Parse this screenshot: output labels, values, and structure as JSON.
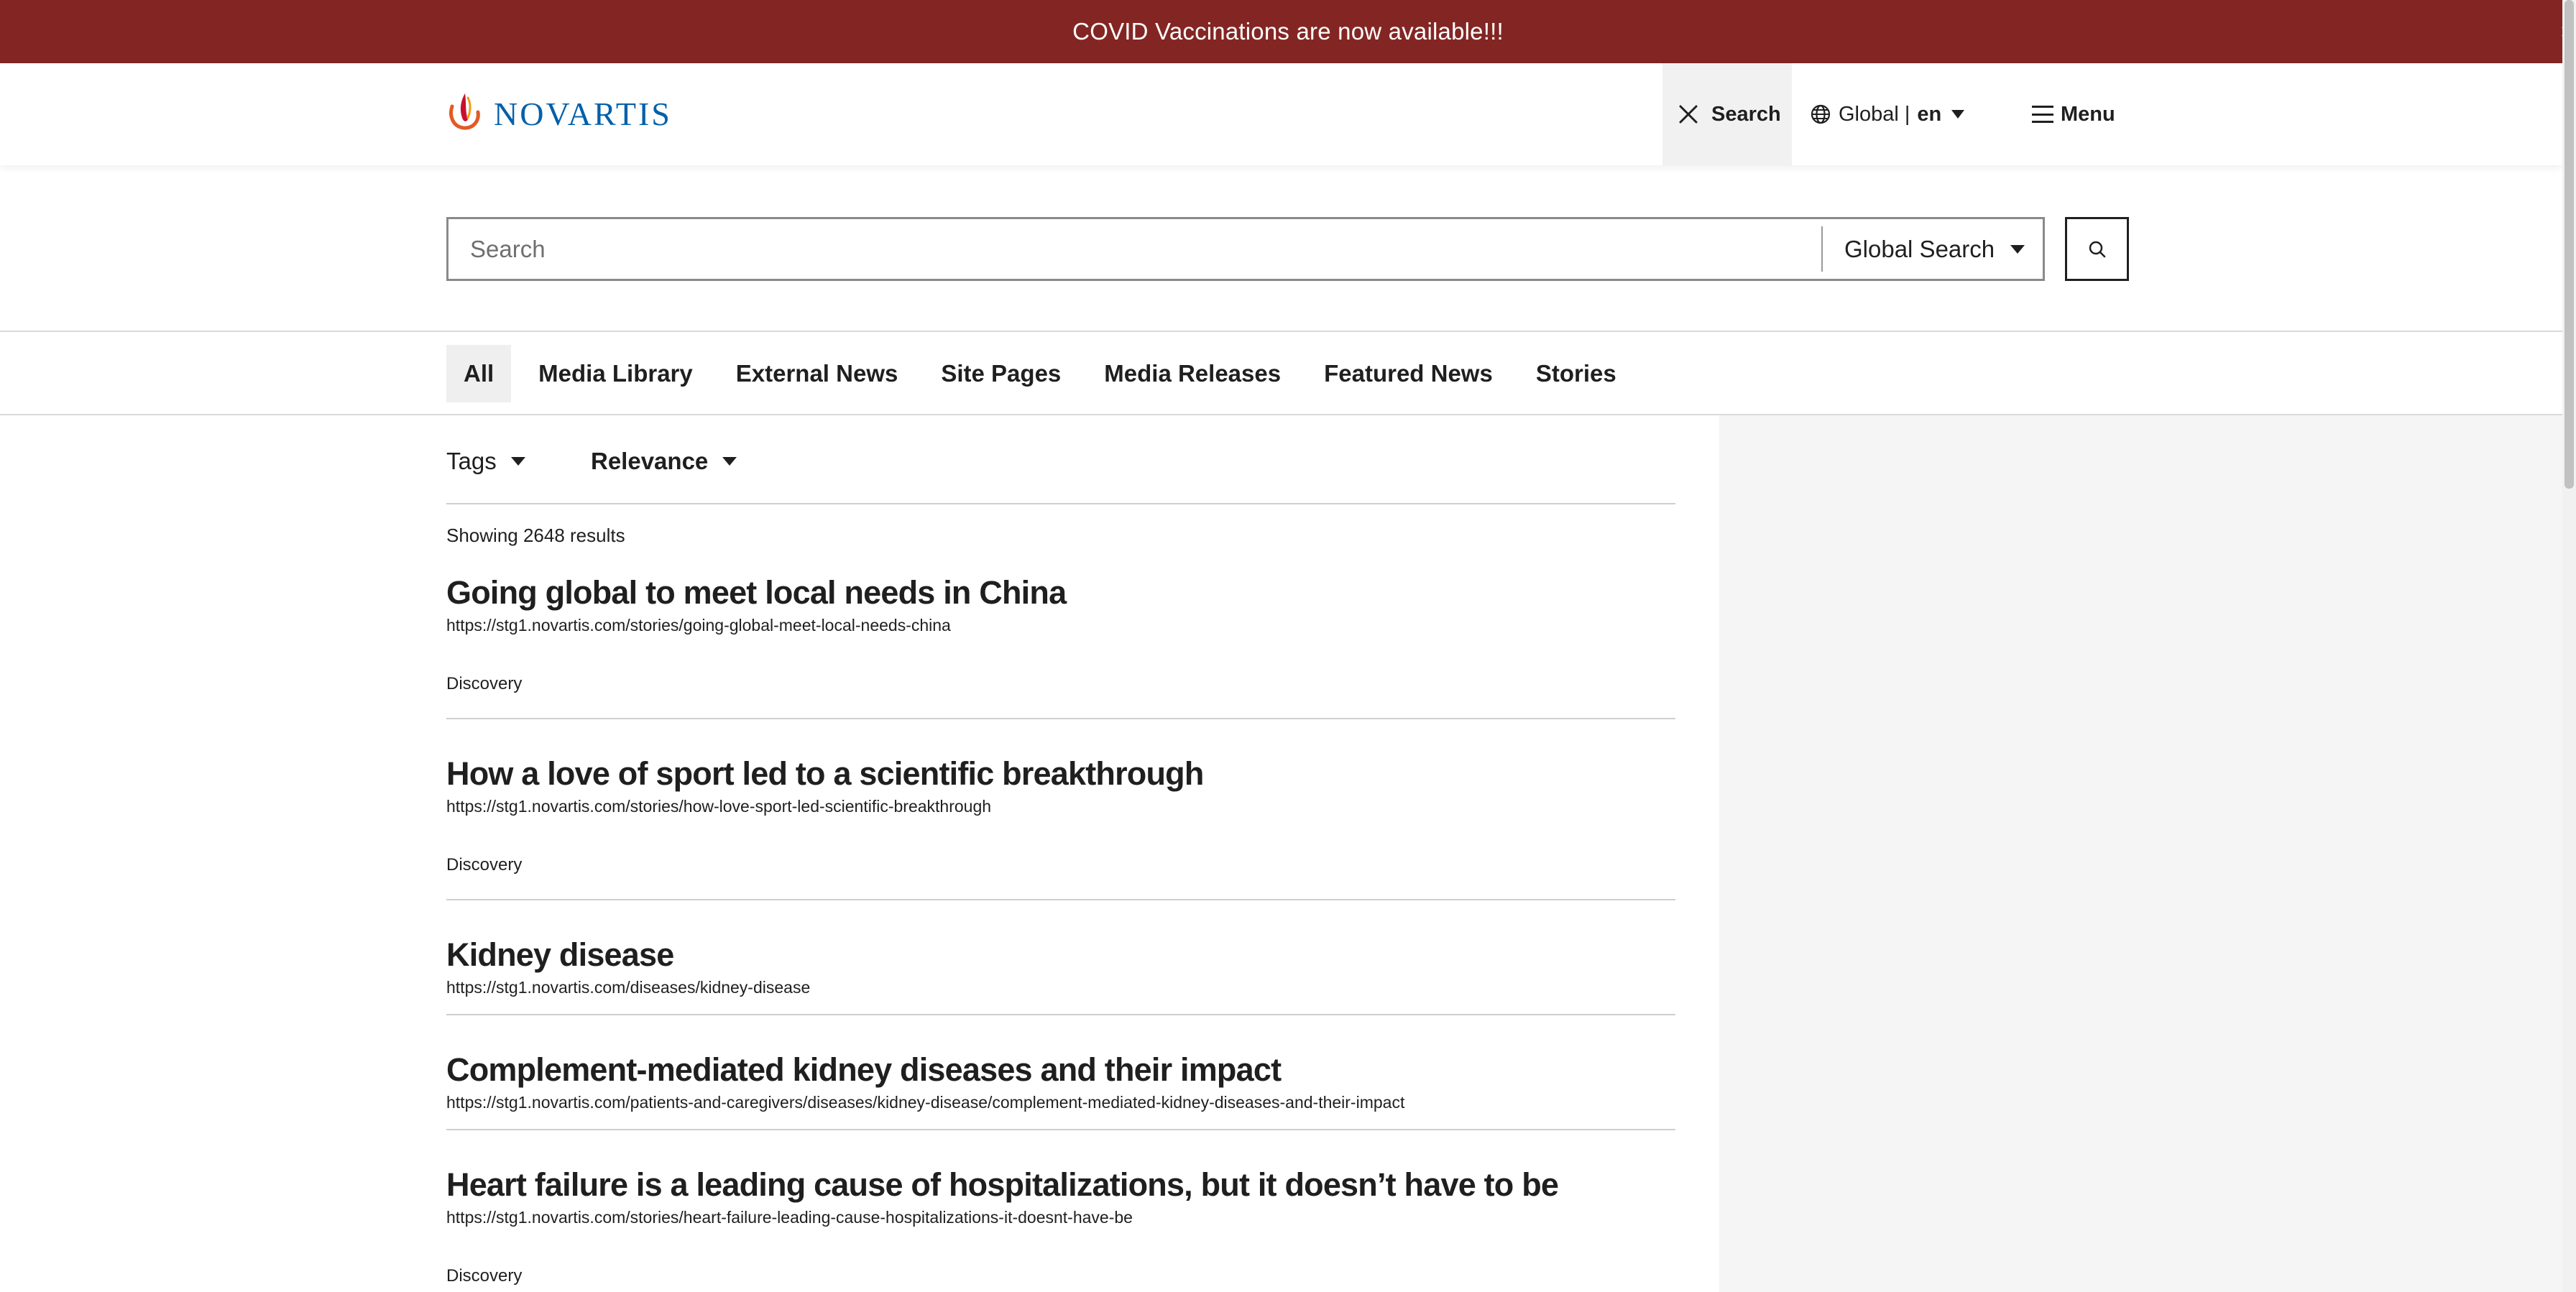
{
  "banner": {
    "text": "COVID Vaccinations are now available!!!",
    "close_label": "×"
  },
  "header": {
    "logo_text": "NOVARTIS",
    "search_label": "Search",
    "lang_region": "Global |",
    "lang_code": "en",
    "menu_label": "Menu"
  },
  "search": {
    "placeholder": "Search",
    "value": "",
    "scope": "Global Search"
  },
  "tabs": [
    {
      "label": "All"
    },
    {
      "label": "Media Library"
    },
    {
      "label": "External News"
    },
    {
      "label": "Site Pages"
    },
    {
      "label": "Media Releases"
    },
    {
      "label": "Featured News"
    },
    {
      "label": "Stories"
    }
  ],
  "filters": {
    "tags_label": "Tags",
    "sort_label": "Relevance"
  },
  "result_count": "Showing 2648 results",
  "results": [
    {
      "title": "Going global to meet local needs in China",
      "url": "https://stg1.novartis.com/stories/going-global-meet-local-needs-china",
      "tag": "Discovery"
    },
    {
      "title": "How a love of sport led to a scientific breakthrough",
      "url": "https://stg1.novartis.com/stories/how-love-sport-led-scientific-breakthrough",
      "tag": "Discovery"
    },
    {
      "title": "Kidney disease",
      "url": "https://stg1.novartis.com/diseases/kidney-disease",
      "tag": ""
    },
    {
      "title": "Complement-mediated kidney diseases and their impact",
      "url": "https://stg1.novartis.com/patients-and-caregivers/diseases/kidney-disease/complement-mediated-kidney-diseases-and-their-impact",
      "tag": ""
    },
    {
      "title": "Heart failure is a leading cause of hospitalizations, but it doesn’t have to be",
      "url": "https://stg1.novartis.com/stories/heart-failure-leading-cause-hospitalizations-it-doesnt-have-be",
      "tag": "Discovery"
    }
  ],
  "colors": {
    "banner": "#832623",
    "logo_blue": "#0460a9",
    "logo_flame_orange": "#e35925",
    "logo_flame_red": "#c8102e"
  }
}
